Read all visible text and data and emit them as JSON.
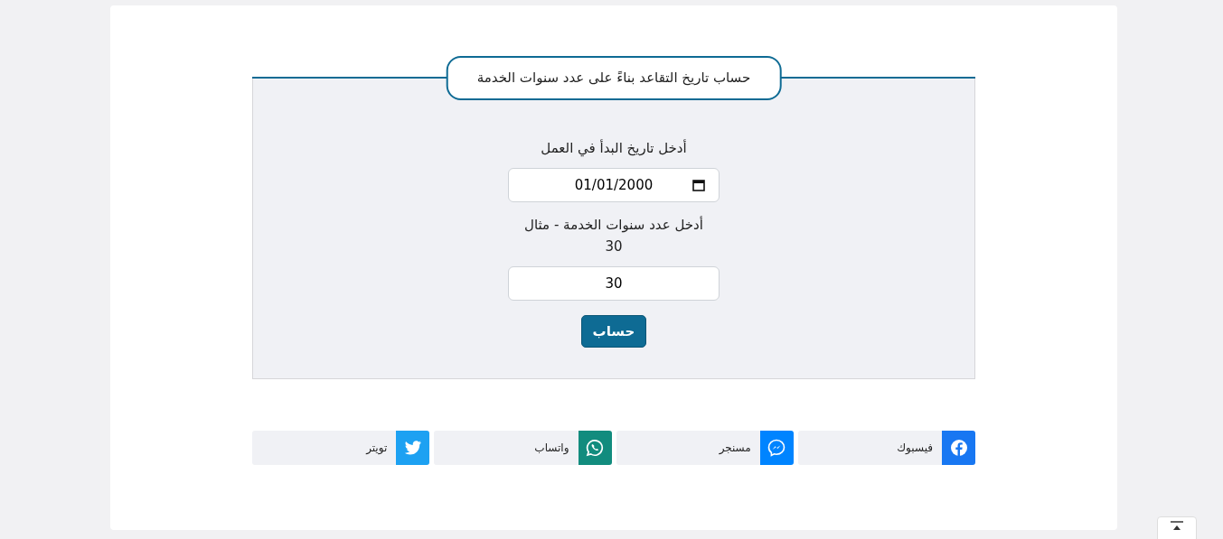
{
  "calculator": {
    "title": "حساب تاريخ التقاعد بناءً على عدد سنوات الخدمة",
    "fields": [
      {
        "kind": "date",
        "label": "أدخل تاريخ البدأ في العمل",
        "value": "01/01/2000"
      },
      {
        "kind": "number",
        "label": "أدخل عدد سنوات الخدمة - مثال 30",
        "value": "30"
      }
    ],
    "button": "حساب"
  },
  "share_buttons": [
    {
      "kind": "facebook",
      "label": "فيسبوك",
      "color": "#1877f2"
    },
    {
      "kind": "messenger",
      "label": "مسنجر",
      "color": "#0084ff"
    },
    {
      "kind": "whatsapp",
      "label": "واتساب",
      "color": "#128c7e"
    },
    {
      "kind": "twitter",
      "label": "تويتر",
      "color": "#1da1f2"
    }
  ]
}
